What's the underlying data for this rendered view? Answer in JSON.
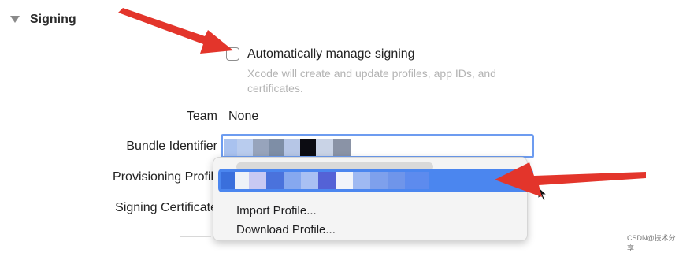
{
  "section": {
    "title": "Signing"
  },
  "auto_signing": {
    "label": "Automatically manage signing",
    "checked": false,
    "help": "Xcode will create and update profiles, app IDs, and certificates."
  },
  "team": {
    "label": "Team",
    "value": "None"
  },
  "bundle": {
    "label": "Bundle Identifier"
  },
  "provisioning": {
    "label": "Provisioning Profile"
  },
  "certificate": {
    "label": "Signing Certificate"
  },
  "menu": {
    "items": [
      {
        "label": "Import Profile..."
      },
      {
        "label": "Download Profile..."
      }
    ]
  },
  "watermark": "CSDN@技术分享",
  "colors": {
    "selection": "#4b86ef",
    "field_focus": "#6d9cf0",
    "annotation_arrow": "#e3352b"
  }
}
